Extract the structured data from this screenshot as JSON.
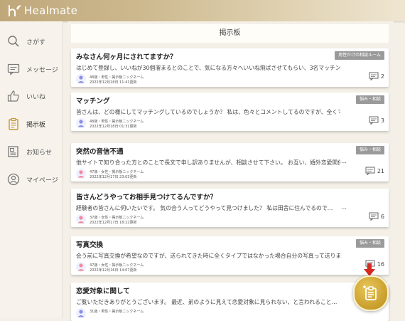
{
  "app": {
    "logo_text": "Healmate"
  },
  "sidebar": {
    "items": [
      {
        "label": "さがす",
        "icon": "search-icon"
      },
      {
        "label": "メッセージ",
        "icon": "message-icon"
      },
      {
        "label": "いいね",
        "icon": "thumbs-up-icon"
      },
      {
        "label": "掲示板",
        "icon": "board-icon",
        "active": true
      },
      {
        "label": "お知らせ",
        "icon": "newspaper-icon"
      },
      {
        "label": "マイページ",
        "icon": "user-icon"
      }
    ]
  },
  "main": {
    "title": "掲示板"
  },
  "posts": [
    {
      "title": "みなさん何ヶ月にされてますか？",
      "badge": "男性だけの相談ルーム",
      "excerpt": "はじめて登録し、いいねが30個溜まるとのことで、気になる方々へいいね飛ばさせてもらい、3名マッチング…",
      "meta1": "48歳・男性・掲示板ニックネーム",
      "meta2": "2022年12月18日 11:41更新",
      "comments": "2",
      "avatar_color": "#8a8fe0",
      "show_ellipsis": false
    },
    {
      "title": "マッチング",
      "badge": "悩み・相談",
      "excerpt": "皆さんは、どの様にしてマッチングしているのでしょうか？ 私は、色々とコメントしてるのですが、全くマ…",
      "meta1": "48歳・男性・掲示板ニックネーム",
      "meta2": "2022年12月18日 01:31更新",
      "comments": "3",
      "avatar_color": "#8a8fe0",
      "show_ellipsis": false
    },
    {
      "title": "突然の音信不通",
      "badge": "悩み・相談",
      "excerpt": "他サイトで知り合った方とのことで長文で申し訳ありませんが、相談させて下さい。 お互い、婚外恋愛関係",
      "meta1": "47歳・女性・掲示板ニックネーム",
      "meta2": "2022年12月17日 23:03更新",
      "comments": "21",
      "avatar_color": "#f08aa0",
      "show_ellipsis": true
    },
    {
      "title": "皆さんどうやってお相手見つけてるんですか？",
      "badge": "",
      "excerpt": "経験者の皆さんに伺いたいです。 気の合う人ってどうやって見つけました？ 私は田舎に住んでるので…",
      "meta1": "37歳・女性・掲示板ニックネーム",
      "meta2": "2022年12月17日 18:22更新",
      "comments": "6",
      "avatar_color": "#f08aa0",
      "show_ellipsis": true
    },
    {
      "title": "写真交換",
      "badge": "悩み・相談",
      "excerpt": "会う前に写真交換が希望なのですが、送られてきた時に全くタイプではなかった場合自分の写真って送りますか…",
      "meta1": "47歳・女性・掲示板ニックネーム",
      "meta2": "2022年12月16日 14:07更新",
      "comments": "16",
      "avatar_color": "#f08aa0",
      "show_ellipsis": false
    },
    {
      "title": "恋愛対象に関して",
      "badge": "",
      "excerpt": "ご覧いただきありがとうございます。 最近、弟のように見えて恋愛対象に見られない、と言われること…",
      "meta1": "31歳・男性・掲示板ニックネーム",
      "meta2": "",
      "comments": "",
      "avatar_color": "#8a8fe0",
      "show_ellipsis": false
    }
  ],
  "fab": {
    "icon": "new-post-icon",
    "accent": "#c89e2c"
  },
  "colors": {
    "topbar": "#cdb98f",
    "badge": "#9a9a9a",
    "arrow": "#d42a1f"
  }
}
